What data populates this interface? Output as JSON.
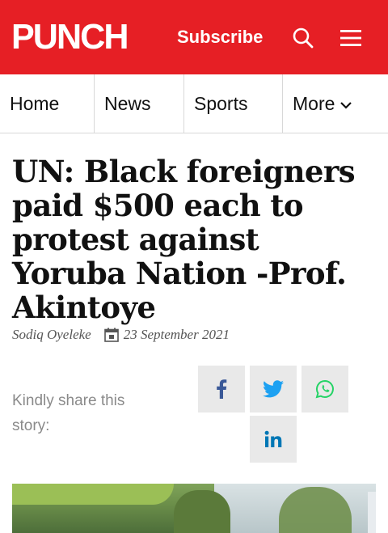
{
  "header": {
    "logo": "PUNCH",
    "subscribe_label": "Subscribe",
    "search_icon": "search-icon",
    "menu_icon": "hamburger-menu-icon",
    "background_color": "#e61f25"
  },
  "nav": {
    "items": [
      {
        "label": "Home"
      },
      {
        "label": "News"
      },
      {
        "label": "Sports"
      },
      {
        "label": "More"
      }
    ]
  },
  "article": {
    "title": "UN: Black foreigners paid $500 each to protest against Yoruba Nation -Prof. Akintoye",
    "author": "Sodiq Oyeleke",
    "date": "23 September 2021"
  },
  "share": {
    "label": "Kindly share this story:",
    "buttons": [
      {
        "icon": "facebook-icon",
        "color": "#3b5998"
      },
      {
        "icon": "twitter-icon",
        "color": "#1da1f2"
      },
      {
        "icon": "whatsapp-icon",
        "color": "#25d366"
      },
      {
        "icon": "linkedin-icon",
        "color": "#0077b5"
      }
    ]
  }
}
